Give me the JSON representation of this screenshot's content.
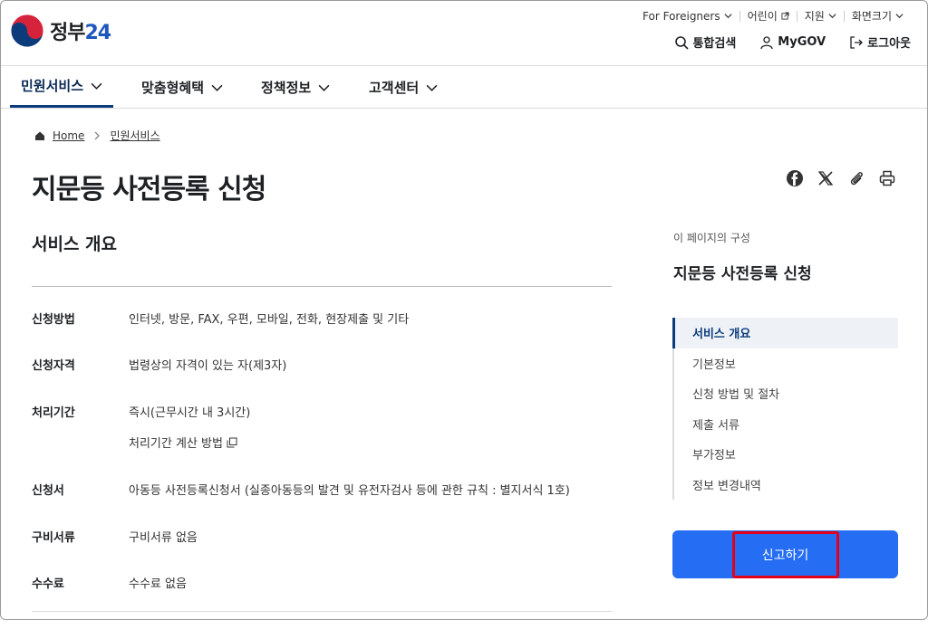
{
  "logo": {
    "text": "정부",
    "num": "24"
  },
  "util": {
    "foreigners": "For Foreigners",
    "kids": "어린이",
    "support": "지원",
    "screen_size": "화면크기"
  },
  "actions": {
    "search": "통합검색",
    "mygov": "MyGOV",
    "logout": "로그아웃"
  },
  "gnb": [
    "민원서비스",
    "맞춤형혜택",
    "정책정보",
    "고객센터"
  ],
  "breadcrumb": {
    "home": "Home",
    "current": "민원서비스"
  },
  "page_title": "지문등 사전등록 신청",
  "section_title": "서비스 개요",
  "info": {
    "method_label": "신청방법",
    "method_value": "인터넷, 방문, FAX, 우편, 모바일, 전화, 현장제출 및 기타",
    "qualification_label": "신청자격",
    "qualification_value": "법령상의 자격이 있는 자(제3자)",
    "period_label": "처리기간",
    "period_value": "즉시(근무시간 내 3시간)",
    "period_calc": "처리기간 계산 방법",
    "form_label": "신청서",
    "form_value": "아동등 사전등록신청서 (실종아동등의 발견 및 유전자검사 등에 관한 규칙 : 별지서식 1호)",
    "docs_label": "구비서류",
    "docs_value": "구비서류 없음",
    "fee_label": "수수료",
    "fee_value": "수수료 없음"
  },
  "side": {
    "caption": "이 페이지의 구성",
    "title": "지문등 사전등록 신청",
    "toc": [
      "서비스 개요",
      "기본정보",
      "신청 방법 및 절차",
      "제출 서류",
      "부가정보",
      "정보 변경내역"
    ],
    "report_button": "신고하기"
  },
  "colors": {
    "primary": "#256ef4",
    "highlight": "#e3001b",
    "nav_active": "#0b3b7a"
  }
}
